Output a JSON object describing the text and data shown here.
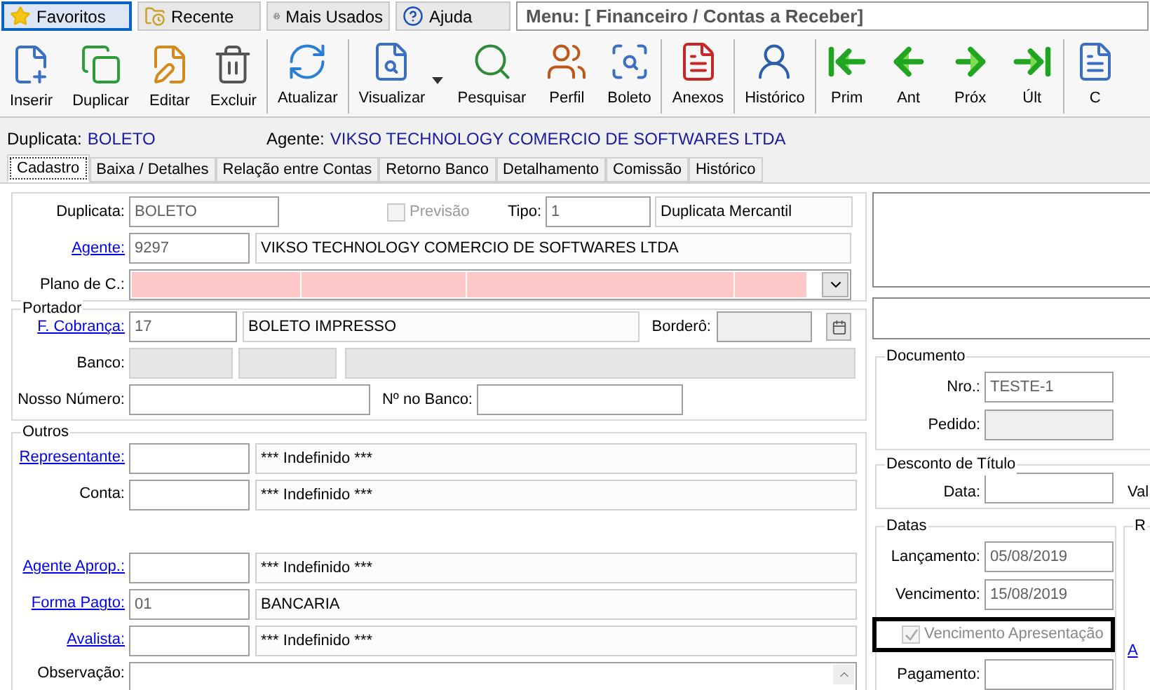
{
  "menu_tabs": [
    {
      "label": "Favoritos",
      "selected": true
    },
    {
      "label": "Recente",
      "selected": false
    },
    {
      "label": "Mais Usados",
      "selected": false
    },
    {
      "label": "Ajuda",
      "selected": false
    }
  ],
  "menu_path": "Menu: [ Financeiro / Contas a Receber]",
  "toolbar_groups": [
    {
      "buttons": [
        {
          "label": "Inserir",
          "dropdown": false
        },
        {
          "label": "Duplicar",
          "dropdown": false
        },
        {
          "label": "Editar",
          "dropdown": false
        },
        {
          "label": "Excluir",
          "dropdown": false
        }
      ]
    },
    {
      "buttons": [
        {
          "label": "Atualizar",
          "dropdown": false
        }
      ]
    },
    {
      "buttons": [
        {
          "label": "Visualizar",
          "dropdown": true
        },
        {
          "label": "Pesquisar",
          "dropdown": false
        },
        {
          "label": "Perfil",
          "dropdown": false
        },
        {
          "label": "Boleto",
          "dropdown": false
        }
      ]
    },
    {
      "buttons": [
        {
          "label": "Anexos",
          "dropdown": false
        }
      ]
    },
    {
      "buttons": [
        {
          "label": "Histórico",
          "dropdown": false
        }
      ]
    },
    {
      "buttons": [
        {
          "label": "Prim",
          "dropdown": false
        },
        {
          "label": "Ant",
          "dropdown": false
        },
        {
          "label": "Próx",
          "dropdown": false
        },
        {
          "label": "Últ",
          "dropdown": false
        }
      ]
    },
    {
      "buttons": [
        {
          "label": "C",
          "dropdown": false
        }
      ]
    }
  ],
  "info": [
    {
      "label": "Duplicata:",
      "value": "BOLETO"
    },
    {
      "label": "Agente:",
      "value": "VIKSO TECHNOLOGY COMERCIO DE SOFTWARES LTDA"
    }
  ],
  "tabs": [
    {
      "label": "Cadastro",
      "selected": true
    },
    {
      "label": "Baixa / Detalhes",
      "selected": false
    },
    {
      "label": "Relação entre Contas",
      "selected": false
    },
    {
      "label": "Retorno Banco",
      "selected": false
    },
    {
      "label": "Detalhamento",
      "selected": false
    },
    {
      "label": "Comissão",
      "selected": false
    },
    {
      "label": "Histórico",
      "selected": false
    }
  ],
  "main": {
    "duplicata": {
      "label": "Duplicata:",
      "link": false,
      "value": "BOLETO"
    },
    "previsao": {
      "label": "Previsão",
      "checked": false,
      "disabled": true
    },
    "tipo": {
      "label": "Tipo:",
      "code": "1",
      "description": "Duplicata Mercantil"
    },
    "agente": {
      "label": "Agente:",
      "link": true,
      "code": "9297",
      "description": "VIKSO TECHNOLOGY COMERCIO DE SOFTWARES LTDA"
    },
    "plano": {
      "label": "Plano de C.:",
      "required": true
    }
  },
  "portador": {
    "title": "Portador",
    "cobranca": {
      "label": "F. Cobrança:",
      "link": true,
      "code": "17",
      "description": "BOLETO IMPRESSO"
    },
    "bordero": {
      "label": "Borderô:",
      "disabled": true
    },
    "banco": {
      "label": "Banco:",
      "disabled": true
    },
    "nosso_numero": {
      "label": "Nosso Número:"
    },
    "numero_banco": {
      "label": "Nº no Banco:"
    }
  },
  "outros": {
    "title": "Outros",
    "blocks": [
      {
        "rows": [
          {
            "label": "Representante:",
            "link": true,
            "description": "*** Indefinido ***"
          },
          {
            "label": "Conta:",
            "link": false,
            "description": "*** Indefinido ***"
          }
        ]
      },
      {
        "rows": [
          {
            "label": "Agente Aprop.:",
            "link": true,
            "description": "*** Indefinido ***"
          },
          {
            "label": "Forma Pagto:",
            "link": true,
            "code": "01",
            "description": "BANCARIA"
          },
          {
            "label": "Avalista:",
            "link": true,
            "description": "*** Indefinido ***"
          }
        ]
      }
    ],
    "observacao": {
      "label": "Observação:"
    }
  },
  "documento": {
    "title": "Documento",
    "nro": {
      "label": "Nro.:",
      "value": "TESTE-1",
      "disabled": false
    },
    "pedido": {
      "label": "Pedido:",
      "disabled": true
    }
  },
  "desconto": {
    "title": "Desconto de Título",
    "data": {
      "label": "Data:"
    },
    "column_2_label": "Val"
  },
  "datas": {
    "title": "Datas",
    "lancamento": {
      "label": "Lançamento:",
      "value": "05/08/2019"
    },
    "vencimento": {
      "label": "Vencimento:",
      "value": "15/08/2019"
    },
    "apresentacao": {
      "label": "Vencimento Apresentação",
      "checked": true,
      "disabled": true,
      "highlighted": true
    },
    "pagamento": {
      "label": "Pagamento:"
    }
  },
  "group_r": {
    "title": "R",
    "link": "A"
  }
}
